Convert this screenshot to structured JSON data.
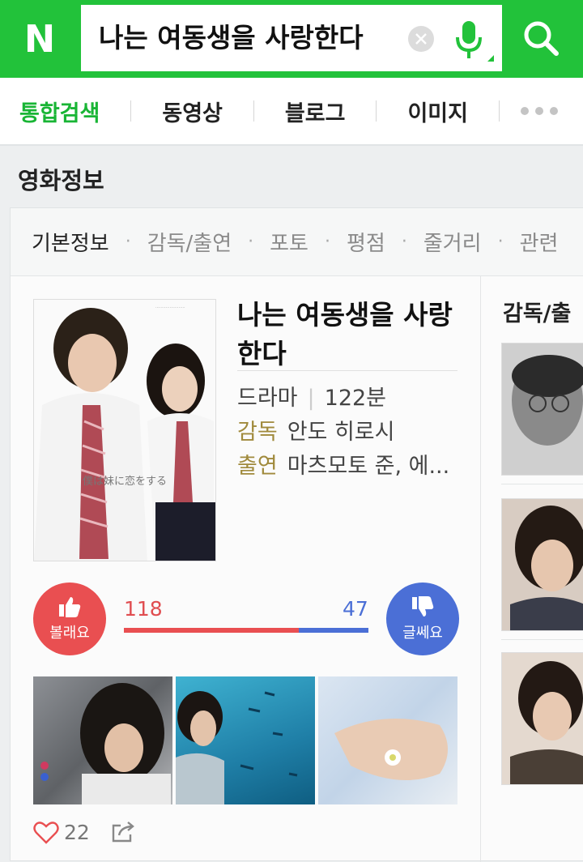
{
  "header": {
    "logo_text": "N",
    "search_value": "나는 여동생을 사랑한다",
    "brand_color": "#22c23a"
  },
  "tabs": {
    "items": [
      "통합검색",
      "동영상",
      "블로그",
      "이미지"
    ],
    "more": "more-dots-icon"
  },
  "section": {
    "title": "영화정보"
  },
  "subtabs": {
    "items": [
      "기본정보",
      "감독/출연",
      "포토",
      "평점",
      "줄거리",
      "관련"
    ]
  },
  "movie": {
    "title": "나는 여동생을 사랑한다",
    "genre": "드라마",
    "runtime": "122분",
    "director_key": "감독",
    "director": "안도 히로시",
    "cast_key": "출연",
    "cast": "마츠모토 준, 에..."
  },
  "votes": {
    "like_label": "볼래요",
    "like_count": "118",
    "meh_label": "글쎄요",
    "meh_count": "47",
    "like_ratio": 0.715
  },
  "social": {
    "like_count": "22"
  },
  "right": {
    "title": "감독/출"
  }
}
